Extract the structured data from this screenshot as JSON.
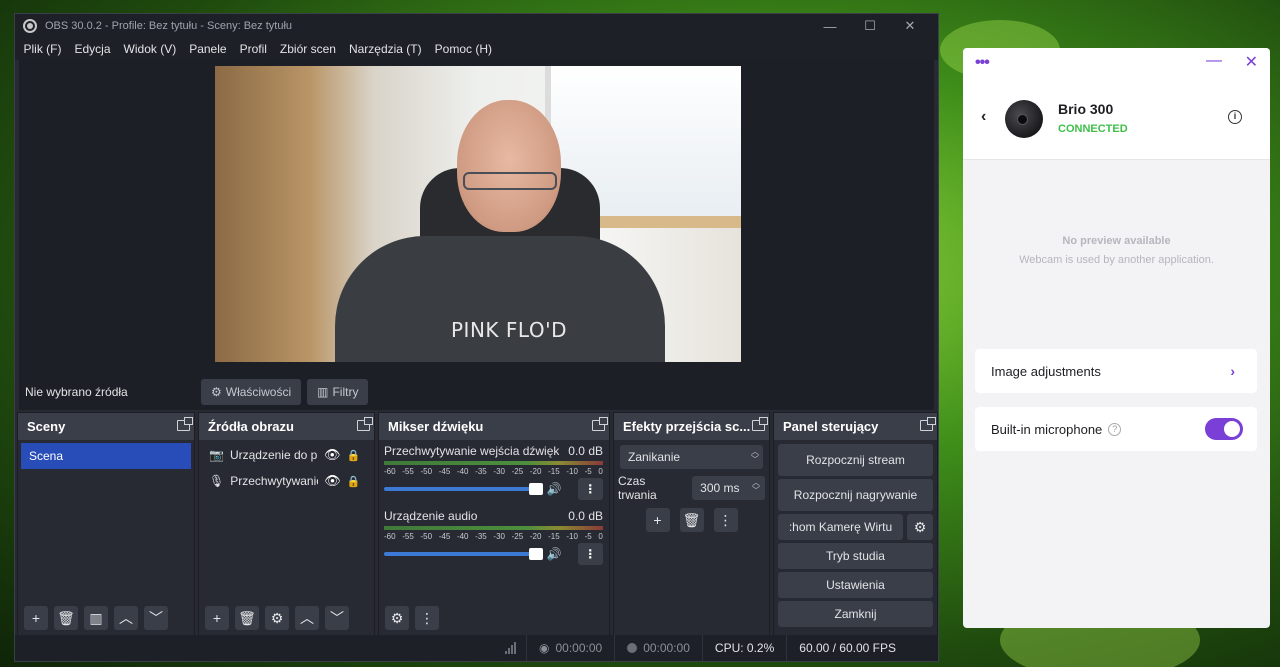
{
  "obs": {
    "title": "OBS 30.0.2 - Profile: Bez tytułu - Sceny: Bez tytułu",
    "window_controls": {
      "minimize": "—",
      "maximize": "☐",
      "close": "✕"
    },
    "menu": [
      "Plik (F)",
      "Edycja",
      "Widok (V)",
      "Panele",
      "Profil",
      "Zbiór scen",
      "Narzędzia (T)",
      "Pomoc (H)"
    ],
    "preview": {
      "shirt_text": "PINK FLO'D"
    },
    "source_toolbar": {
      "no_source": "Nie wybrano źródła",
      "properties": "Właściwości",
      "filters": "Filtry"
    },
    "scenes": {
      "title": "Sceny",
      "items": [
        "Scena"
      ]
    },
    "sources": {
      "title": "Źródła obrazu",
      "items": [
        {
          "name": "Urządzenie do przechwytywania",
          "icon": "camera-icon"
        },
        {
          "name": "Przechwytywanie wejścia dźwięku",
          "icon": "microphone-icon"
        }
      ]
    },
    "mixer": {
      "title": "Mikser dźwięku",
      "channels": [
        {
          "name": "Przechwytywanie wejścia dźwięku",
          "level": "0.0 dB",
          "volume": 1.0
        },
        {
          "name": "Urządzenie audio",
          "level": "0.0 dB",
          "volume": 1.0
        }
      ],
      "ticks": [
        "-60",
        "-55",
        "-50",
        "-45",
        "-40",
        "-35",
        "-30",
        "-25",
        "-20",
        "-15",
        "-10",
        "-5",
        "0"
      ]
    },
    "transitions": {
      "title": "Efekty przejścia sc...",
      "selected": "Zanikanie",
      "duration_label": "Czas trwania",
      "duration_value": "300 ms"
    },
    "controls": {
      "title": "Panel sterujący",
      "start_stream": "Rozpocznij stream",
      "start_record": "Rozpocznij nagrywanie",
      "virtual_cam": ":hom Kamerę Wirtu",
      "studio_mode": "Tryb studia",
      "settings": "Ustawienia",
      "exit": "Zamknij"
    },
    "status": {
      "stream_time": "00:00:00",
      "record_time": "00:00:00",
      "cpu": "CPU: 0.2%",
      "fps": "60.00 / 60.00 FPS"
    }
  },
  "logi": {
    "device_name": "Brio 300",
    "device_status": "CONNECTED",
    "no_preview": "No preview available",
    "no_preview_reason": "Webcam is used by another application.",
    "image_adjustments": "Image adjustments",
    "builtin_mic": "Built-in microphone",
    "mic_enabled": true,
    "accent": "#7a3fd6",
    "status_color": "#3fbf4a"
  },
  "theme": {
    "obs_bg": "#272a33",
    "obs_dock_header": "#3a3e49",
    "scene_selected": "#284cb8"
  }
}
